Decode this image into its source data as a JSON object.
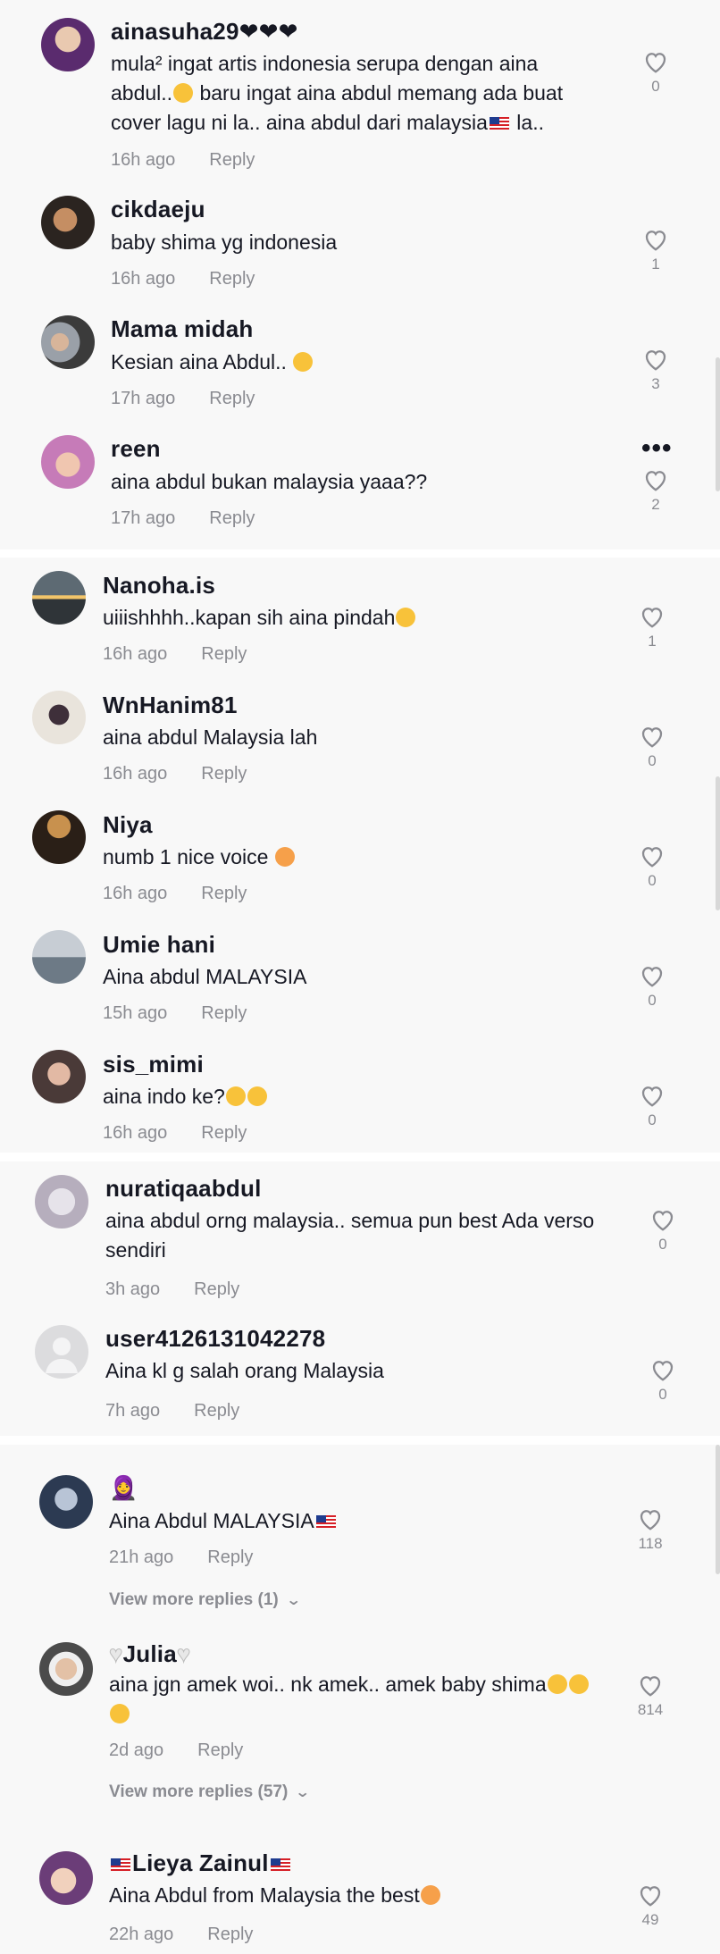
{
  "screenshots": [
    {
      "comments": [
        {
          "username": "ainasuha29❤❤❤",
          "text": "mula² ingat artis indonesia serupa dengan aina abdul..😅 baru ingat aina abdul memang ada buat cover lagu ni la.. aina abdul dari malaysia🇲🇾 la..",
          "time": "16h ago",
          "reply": "Reply",
          "likes": "0",
          "avatar": "avatar-ainasuha29"
        },
        {
          "username": "cikdaeju",
          "text": "baby shima yg indonesia",
          "time": "16h ago",
          "reply": "Reply",
          "likes": "1",
          "avatar": "avatar-cikdaeju"
        },
        {
          "username": "Mama midah",
          "text": "Kesian aina Abdul.. 😅",
          "time": "17h ago",
          "reply": "Reply",
          "likes": "3",
          "avatar": "avatar-mama-midah"
        },
        {
          "username": "reen",
          "text": "aina abdul bukan malaysia yaaa??",
          "time": "17h ago",
          "reply": "Reply",
          "likes": "2",
          "avatar": "avatar-reen",
          "more": "•••"
        }
      ]
    },
    {
      "comments": [
        {
          "username": "Nanoha.is",
          "text": "uiiishhhh..kapan sih aina pindah😂",
          "time": "16h ago",
          "reply": "Reply",
          "likes": "1"
        },
        {
          "username": "WnHanim81",
          "text": "aina abdul Malaysia lah",
          "time": "16h ago",
          "reply": "Reply",
          "likes": "0"
        },
        {
          "username": "Niya",
          "text": "numb 1 nice voice 🥰",
          "time": "16h ago",
          "reply": "Reply",
          "likes": "0"
        },
        {
          "username": "Umie hani",
          "text": "Aina abdul MALAYSIA",
          "time": "15h ago",
          "reply": "Reply",
          "likes": "0"
        },
        {
          "username": "sis_mimi",
          "text": "aina indo ke?😅😅",
          "time": "16h ago",
          "reply": "Reply",
          "likes": "0"
        }
      ]
    },
    {
      "comments": [
        {
          "username": "nuratiqaabdul",
          "text": "aina abdul orng malaysia.. semua pun best Ada verso sendiri",
          "time": "3h ago",
          "reply": "Reply",
          "likes": "0"
        },
        {
          "username": "user4126131042278",
          "text": "Aina kl g salah orang Malaysia",
          "time": "7h ago",
          "reply": "Reply",
          "likes": "0"
        }
      ]
    },
    {
      "comments": [
        {
          "username": "🧕",
          "text": "Aina Abdul MALAYSIA🇲🇾",
          "time": "21h ago",
          "reply": "Reply",
          "likes": "118",
          "view_more": "View more replies (1)"
        },
        {
          "username": "🤍Julia🤍",
          "text": "aina jgn amek woi.. nk amek.. amek baby shima😂😂😂",
          "time": "2d ago",
          "reply": "Reply",
          "likes": "814",
          "view_more": "View more replies (57)"
        },
        {
          "username": "🇲🇾Lieya Zainul🇲🇾",
          "text": "Aina Abdul from Malaysia the best🥰",
          "time": "22h ago",
          "reply": "Reply",
          "likes": "49"
        }
      ]
    }
  ],
  "colors": {
    "background": "#f8f8f8",
    "text": "#161823",
    "secondary": "#8a8b91",
    "separator": "#ffffff"
  },
  "icons": {
    "like": "heart-outline-icon",
    "more": "more-dots-icon",
    "expand": "chevron-down-icon"
  }
}
